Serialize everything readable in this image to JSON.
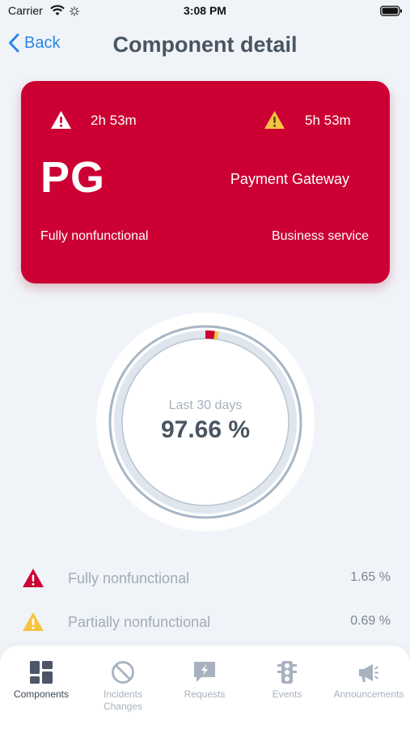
{
  "status_bar": {
    "carrier": "Carrier",
    "time": "3:08 PM"
  },
  "nav": {
    "back_label": "Back",
    "title": "Component detail"
  },
  "card": {
    "color": "#cc0033",
    "full_duration": "2h 53m",
    "partial_duration": "5h 53m",
    "abbreviation": "PG",
    "name": "Payment Gateway",
    "state": "Fully nonfunctional",
    "type": "Business service"
  },
  "availability": {
    "caption": "Last 30 days",
    "value_label": "97.66 %",
    "operational_pct": 97.66,
    "full_outage_pct": 1.65,
    "partial_outage_pct": 0.69
  },
  "legend": [
    {
      "label": "Fully nonfunctional",
      "pct": "1.65 %",
      "color": "#cc0033",
      "icon": "red-warning-triangle-icon"
    },
    {
      "label": "Partially nonfunctional",
      "pct": "0.69 %",
      "color": "#f6c443",
      "icon": "yellow-warning-triangle-icon"
    }
  ],
  "tabs": [
    {
      "label": "Components",
      "icon": "components-grid-icon",
      "active": true
    },
    {
      "label": "Incidents",
      "label2": "Changes",
      "icon": "prohibited-circle-icon",
      "active": false
    },
    {
      "label": "Requests",
      "icon": "request-bubble-icon",
      "active": false
    },
    {
      "label": "Events",
      "icon": "traffic-light-icon",
      "active": false
    },
    {
      "label": "Announcements",
      "icon": "megaphone-icon",
      "active": false
    }
  ]
}
